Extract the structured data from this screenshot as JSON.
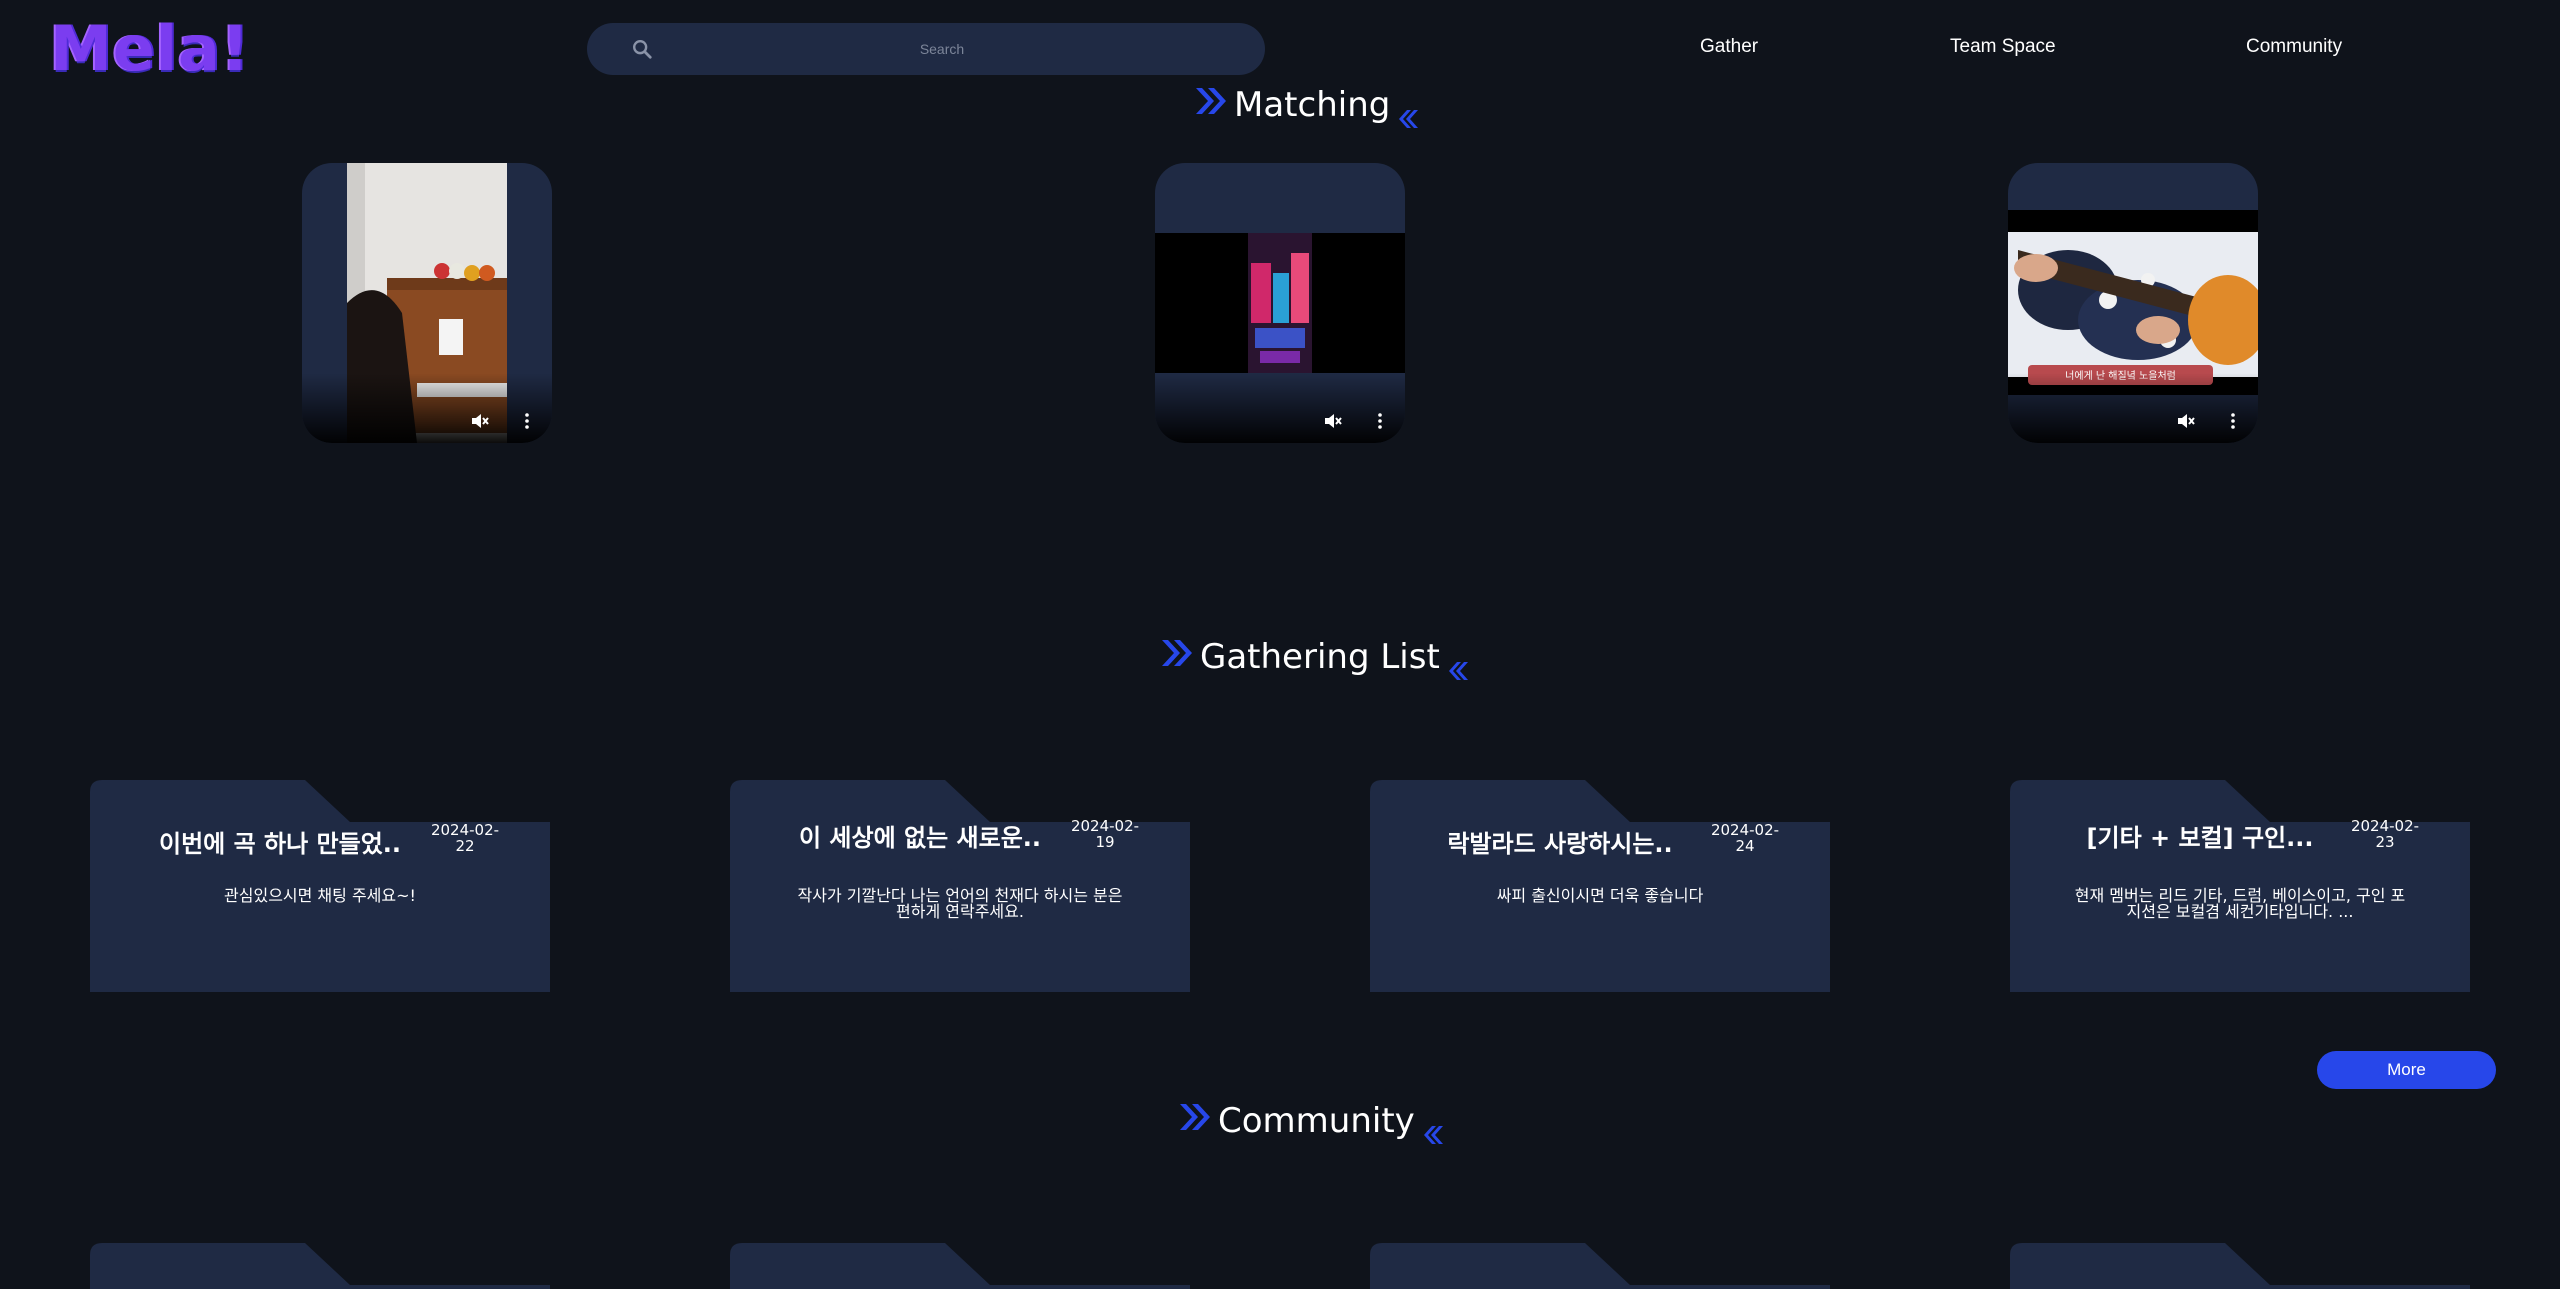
{
  "header": {
    "logo_text": "Mela!",
    "search": {
      "placeholder": "Search",
      "value": ""
    },
    "nav": [
      {
        "label": "Gather"
      },
      {
        "label": "Team Space"
      },
      {
        "label": "Community"
      }
    ]
  },
  "sections": {
    "matching": {
      "title": "Matching"
    },
    "gathering": {
      "title": "Gathering List"
    },
    "community": {
      "title": "Community"
    }
  },
  "videos": [
    {
      "subject": "piano",
      "muted": true
    },
    {
      "subject": "city-night",
      "muted": true
    },
    {
      "subject": "ukulele",
      "muted": true,
      "caption": "너에게 난 해질녘 노을처럼"
    }
  ],
  "gatherings": [
    {
      "title": "이번에 곡 하나 만들었..",
      "date": "2024-02-22",
      "desc": "관심있으시면 채팅 주세요~!"
    },
    {
      "title": "이 세상에 없는 새로운..",
      "date": "2024-02-19",
      "desc": "작사가 기깔난다 나는 언어의 천재다 하시는 분은 편하게 연락주세요."
    },
    {
      "title": "락발라드 사랑하시는..",
      "date": "2024-02-24",
      "desc": "싸피 출신이시면 더욱 좋습니다"
    },
    {
      "title": "[기타 + 보컬] 구인...",
      "date": "2024-02-23",
      "desc": "현재 멤버는 리드 기타, 드럼, 베이스이고, 구인 포지션은 보컬겸 세컨기타입니다. ..."
    }
  ],
  "more_button": {
    "label": "More"
  },
  "colors": {
    "background": "#0f131b",
    "card": "#1f2a44",
    "accent": "#2747ea",
    "logo": "#7b3df0"
  },
  "icons": {
    "search": "search-icon",
    "section_prefix": "double-chevron-right-icon",
    "section_suffix": "double-chevron-left-icon",
    "mute": "volume-mute-icon",
    "more": "more-vertical-icon"
  }
}
